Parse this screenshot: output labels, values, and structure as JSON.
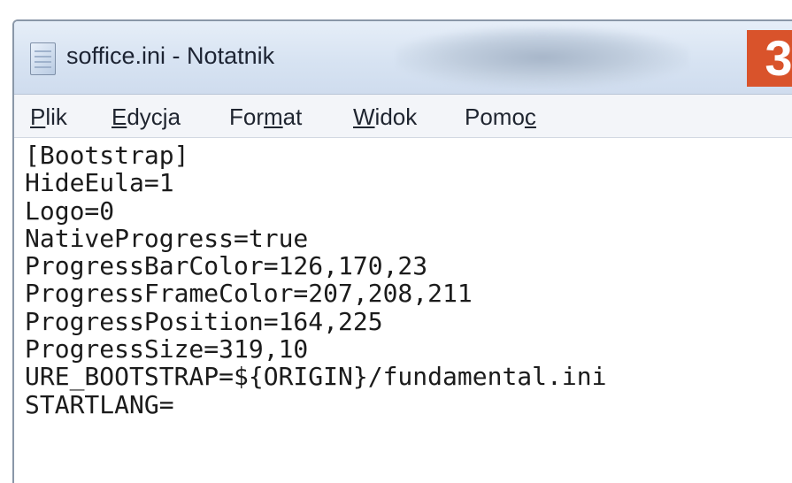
{
  "window": {
    "title": "soffice.ini - Notatnik",
    "badge": "3",
    "badge_color": "#d9532b",
    "icon": "notepad-file-icon"
  },
  "menu": [
    {
      "label": "Plik",
      "mnemonic": "P"
    },
    {
      "label": "Edycja",
      "mnemonic": "E"
    },
    {
      "label": "Format",
      "mnemonic": "m"
    },
    {
      "label": "Widok",
      "mnemonic": "W"
    },
    {
      "label": "Pomoc",
      "mnemonic": "c"
    }
  ],
  "editor": {
    "lines": [
      "[Bootstrap]",
      "HideEula=1",
      "Logo=0",
      "NativeProgress=true",
      "ProgressBarColor=126,170,23",
      "ProgressFrameColor=207,208,211",
      "ProgressPosition=164,225",
      "ProgressSize=319,10",
      "URE_BOOTSTRAP=${ORIGIN}/fundamental.ini",
      "STARTLANG="
    ]
  }
}
